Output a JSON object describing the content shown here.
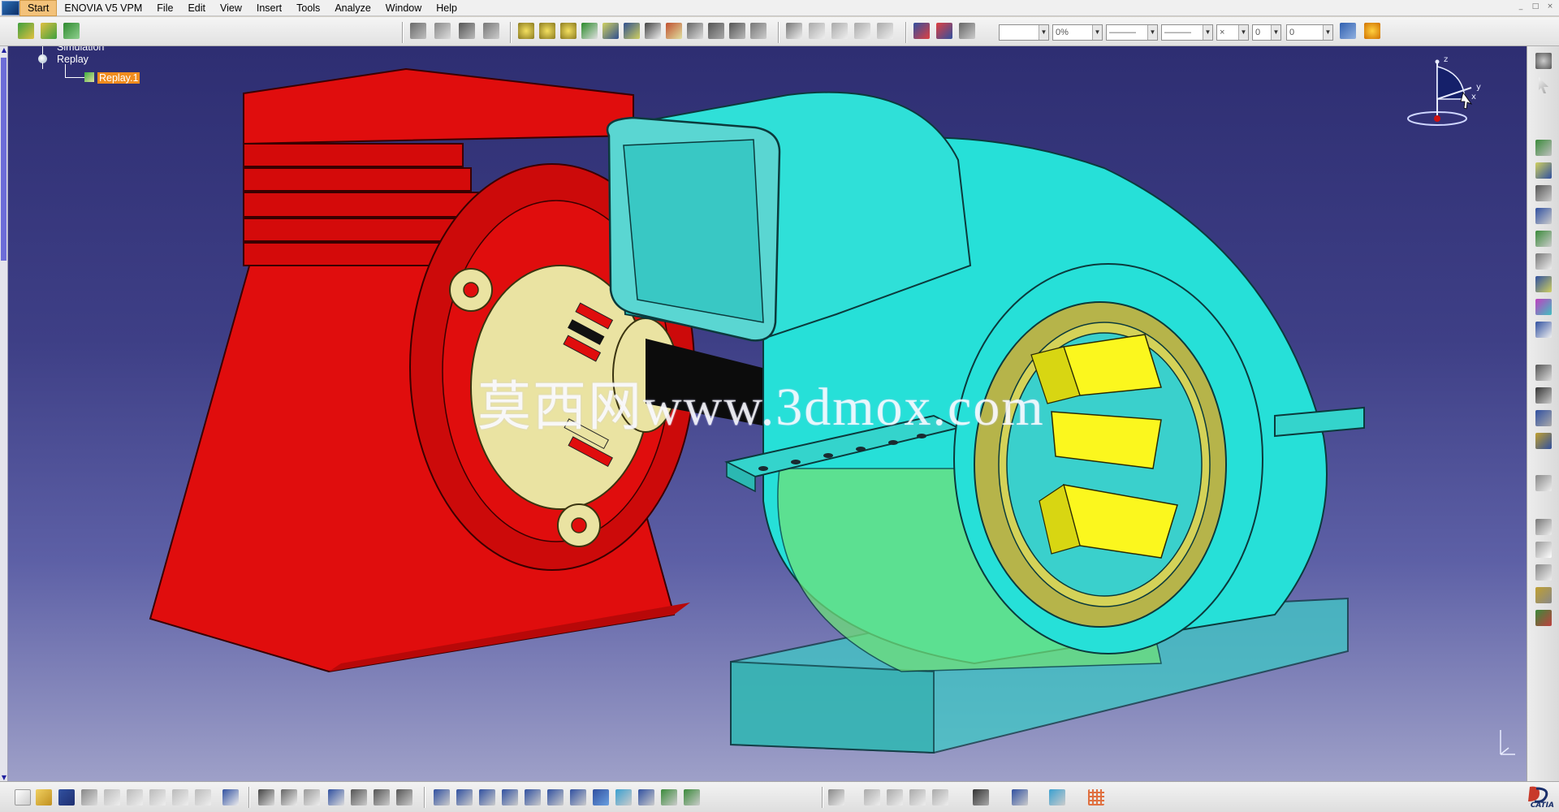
{
  "menu": {
    "items": [
      "Start",
      "ENOVIA V5 VPM",
      "File",
      "Edit",
      "View",
      "Insert",
      "Tools",
      "Analyze",
      "Window",
      "Help"
    ],
    "active": "Start"
  },
  "window_controls": [
    "_",
    "□",
    "×"
  ],
  "toolbar": {
    "combo_color": "",
    "combo_transparency": "0%",
    "combo_thickness": "———",
    "combo_linetype": "———",
    "combo_point": "×",
    "combo_layer": "0",
    "combo_layer2": "0"
  },
  "spec_tree": {
    "items": [
      {
        "label": "Simulation",
        "selected": false
      },
      {
        "label": "Replay",
        "selected": false
      },
      {
        "label": "Replay.1",
        "selected": true
      }
    ]
  },
  "watermark": "莫西网www.3dmox.com",
  "compass": {
    "x": "x",
    "y": "y",
    "z": "z"
  },
  "brand": "CATIA",
  "colors": {
    "motor_body": "#e00d0d",
    "casing": "#26e0d8",
    "bearing_cap": "#eae3a2",
    "inlet_ring": "#e2e04a",
    "highlight": "#f08c1e"
  },
  "icons": {
    "top_toolbar": [
      "new-from-icon",
      "insert-product-icon",
      "replace-icon",
      "simulation-icon",
      "track-icon",
      "sequence-icon",
      "replay-icon",
      "compile-icon",
      "swept-volume-icon",
      "clash-icon",
      "distance-icon",
      "sectioning-icon",
      "shuttle-icon",
      "scene-icon",
      "catalog-icon",
      "analysis-icon",
      "update-icon",
      "format-painter-icon"
    ],
    "right_toolbar": [
      "gear-icon",
      "select-cursor-icon",
      "spring-icon",
      "cube-icon",
      "joints-icon",
      "assembly-icon",
      "constraint-icon",
      "fix-icon",
      "plane-icon",
      "snap-icon",
      "explode-icon",
      "measure-icon",
      "sketch-icon",
      "annotation-icon",
      "text-abc-icon",
      "balloon-icon",
      "pin-icon",
      "paint-icon"
    ],
    "bottom_toolbar": [
      "new-file-icon",
      "open-folder-icon",
      "save-icon",
      "print-icon",
      "cut-icon",
      "copy-icon",
      "paste-icon",
      "undo-icon",
      "redo-icon",
      "whats-this-icon",
      "formula-icon",
      "knowledge-icon",
      "table-icon",
      "tree-icon",
      "fly-mode-icon",
      "fit-all-icon",
      "pan-icon",
      "rotate-icon",
      "zoom-in-icon",
      "zoom-out-icon",
      "normal-view-icon",
      "multi-view-icon",
      "iso-view-icon",
      "render-style-icon",
      "hide-show-icon",
      "swap-space-icon",
      "capture-icon",
      "grid-icon",
      "camera-icon"
    ]
  }
}
